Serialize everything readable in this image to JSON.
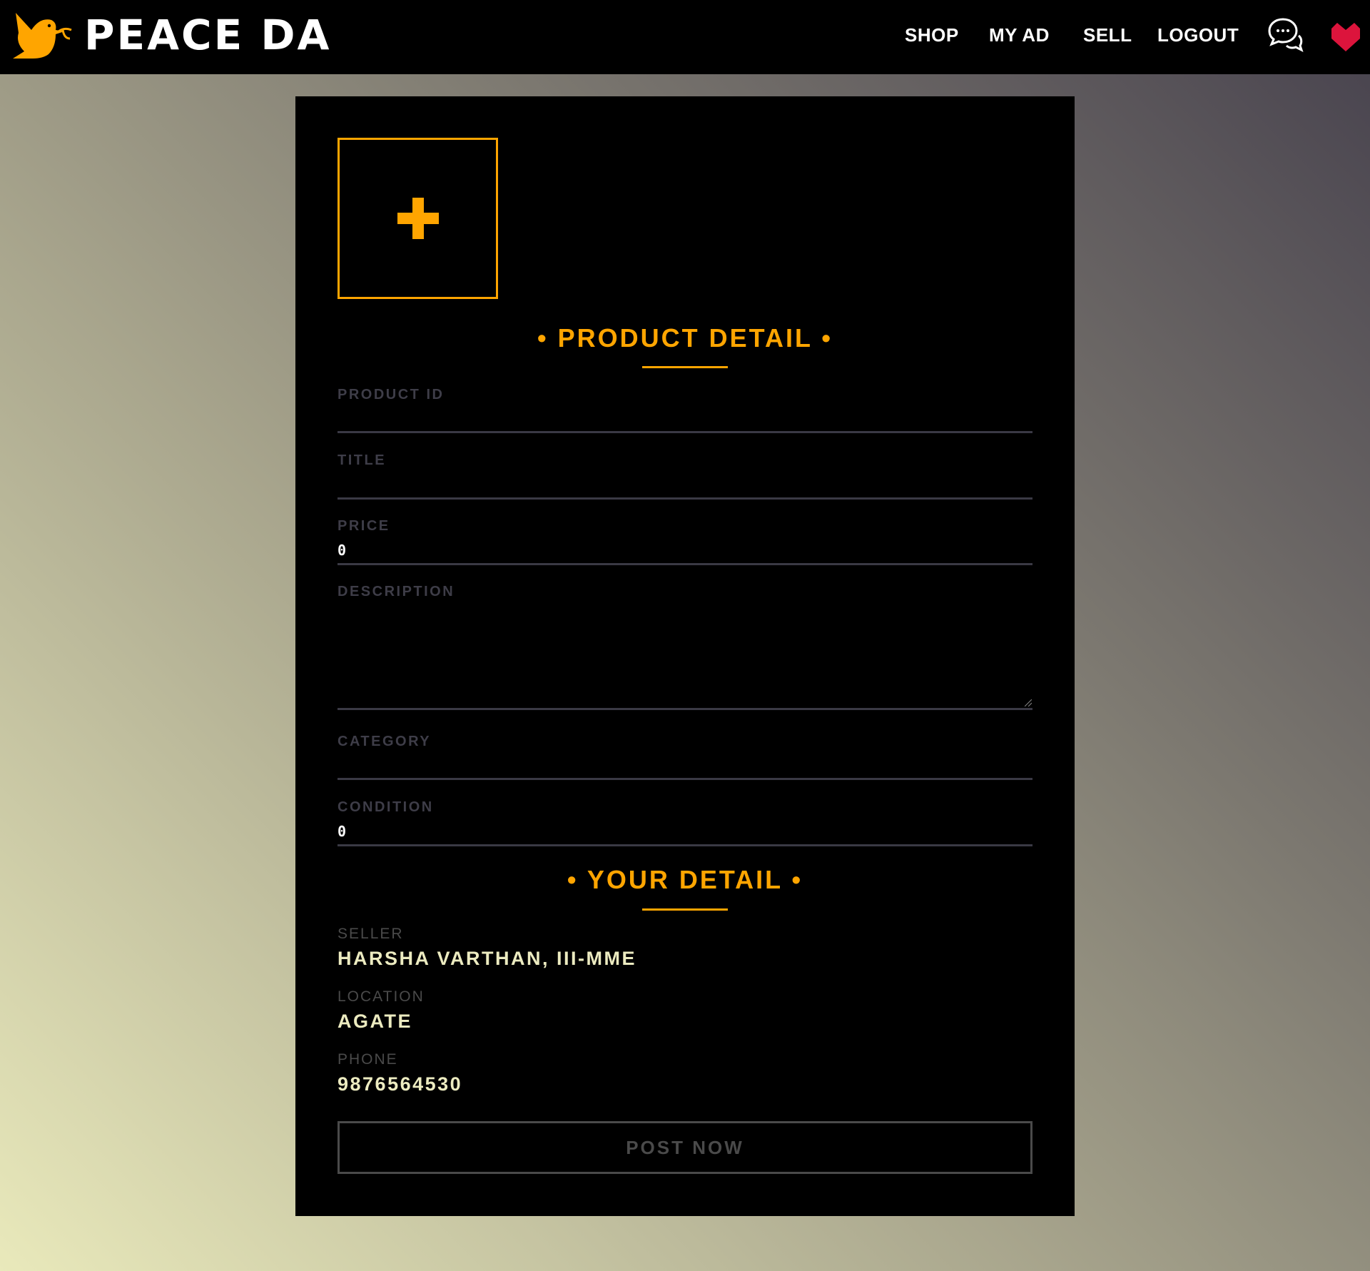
{
  "brand": {
    "name": "PEACE DA",
    "logo_icon": "dove-with-olive-branch",
    "accent": "#ffa500"
  },
  "nav": {
    "items": [
      {
        "label": "SHOP"
      },
      {
        "label": "MY AD"
      },
      {
        "label": "SELL"
      },
      {
        "label": "LOGOUT"
      }
    ],
    "chat_icon": "chat-bubbles-icon",
    "heart_icon": "heart-icon",
    "heart_color": "#dc143c"
  },
  "form": {
    "image_upload_icon": "plus-icon",
    "product_heading": "• PRODUCT DETAIL •",
    "fields": {
      "product_id": {
        "label": "PRODUCT ID",
        "value": ""
      },
      "title": {
        "label": "TITLE",
        "value": ""
      },
      "price": {
        "label": "PRICE",
        "value": "0"
      },
      "description": {
        "label": "DESCRIPTION",
        "value": ""
      },
      "category": {
        "label": "CATEGORY",
        "value": ""
      },
      "condition": {
        "label": "CONDITION",
        "value": "0"
      }
    },
    "your_heading": "• YOUR DETAIL •",
    "seller": {
      "label": "SELLER",
      "value": "HARSHA VARTHAN, III-MME"
    },
    "location": {
      "label": "LOCATION",
      "value": "AGATE"
    },
    "phone": {
      "label": "PHONE",
      "value": "9876564530"
    },
    "submit_label": "POST NOW"
  }
}
